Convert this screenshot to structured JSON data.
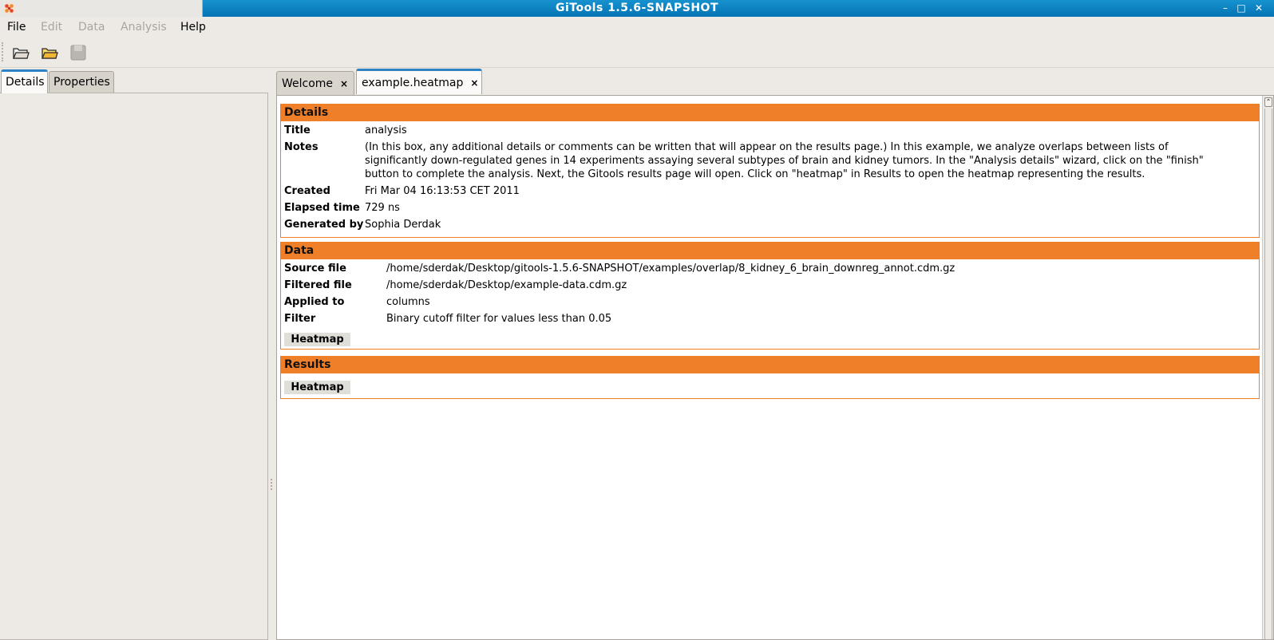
{
  "window": {
    "title": "GiTools 1.5.6-SNAPSHOT",
    "controls": {
      "minimize": "–",
      "maximize": "□",
      "close": "✕"
    }
  },
  "menu": {
    "items": [
      {
        "label": "File",
        "enabled": true
      },
      {
        "label": "Edit",
        "enabled": false
      },
      {
        "label": "Data",
        "enabled": false
      },
      {
        "label": "Analysis",
        "enabled": false
      },
      {
        "label": "Help",
        "enabled": true
      }
    ]
  },
  "toolbar": {
    "buttons": [
      {
        "icon": "open-folder-icon",
        "enabled": true
      },
      {
        "icon": "open-analysis-folder-icon",
        "enabled": true
      },
      {
        "icon": "save-icon",
        "enabled": false
      }
    ]
  },
  "left_panel": {
    "tabs": [
      {
        "label": "Details",
        "active": true
      },
      {
        "label": "Properties",
        "active": false
      }
    ]
  },
  "editor_tabs": [
    {
      "label": "Welcome",
      "close": "×",
      "active": false
    },
    {
      "label": "example.heatmap",
      "close": "×",
      "active": true
    }
  ],
  "details": {
    "header": "Details",
    "rows": [
      {
        "label": "Title",
        "value": "analysis"
      },
      {
        "label": "Notes",
        "value_lines": [
          "(In this box, any additional details or comments can be written that will appear on the results page.) In this example, we analyze overlaps between lists of",
          "significantly down-regulated genes in 14 experiments assaying several subtypes of brain and kidney tumors. In the \"Analysis details\" wizard, click on the \"finish\"",
          "button to complete the analysis. Next, the Gitools results page will open. Click on \"heatmap\" in Results to open the heatmap representing the results."
        ]
      },
      {
        "label": "Created",
        "value": "Fri Mar 04 16:13:53 CET 2011"
      },
      {
        "label": "Elapsed time",
        "value": "729 ns"
      },
      {
        "label": "Generated by",
        "value": "Sophia Derdak"
      }
    ]
  },
  "data_section": {
    "header": "Data",
    "rows": [
      {
        "label": "Source file",
        "value": "/home/sderdak/Desktop/gitools-1.5.6-SNAPSHOT/examples/overlap/8_kidney_6_brain_downreg_annot.cdm.gz"
      },
      {
        "label": "Filtered file",
        "value": "/home/sderdak/Desktop/example-data.cdm.gz"
      },
      {
        "label": "Applied to",
        "value": "columns"
      },
      {
        "label": "Filter",
        "value": "Binary cutoff filter for values less than 0.05"
      }
    ],
    "button": "Heatmap"
  },
  "results_section": {
    "header": "Results",
    "button": "Heatmap"
  },
  "colors": {
    "titlebar": "#0a7dc0",
    "section_header": "#ef7f28",
    "active_tab_accent": "#2f82c4"
  }
}
